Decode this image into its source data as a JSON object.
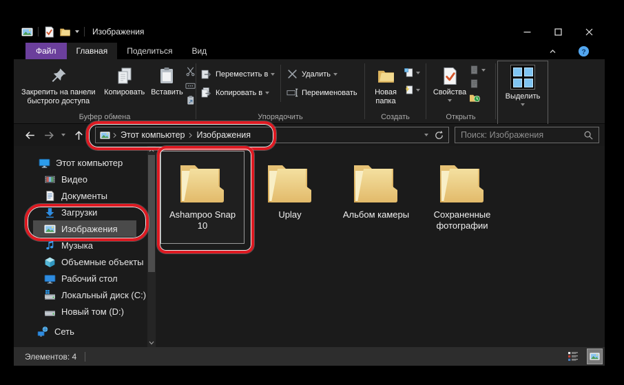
{
  "window": {
    "title": "Изображения"
  },
  "tabs": {
    "file": "Файл",
    "home": "Главная",
    "share": "Поделиться",
    "view": "Вид"
  },
  "ribbon": {
    "pin": "Закрепить на панели быстрого доступа",
    "copy": "Копировать",
    "paste": "Вставить",
    "move_to": "Переместить в",
    "copy_to": "Копировать в",
    "delete": "Удалить",
    "rename": "Переименовать",
    "new_folder": "Новая папка",
    "properties": "Свойства",
    "select": "Выделить",
    "groups": {
      "clipboard": "Буфер обмена",
      "organize": "Упорядочить",
      "create": "Создать",
      "open": "Открыть"
    }
  },
  "address": {
    "crumb_root": "Этот компьютер",
    "crumb_current": "Изображения",
    "search_placeholder": "Поиск: Изображения"
  },
  "sidebar": {
    "items": [
      {
        "label": "Этот компьютер"
      },
      {
        "label": "Видео"
      },
      {
        "label": "Документы"
      },
      {
        "label": "Загрузки"
      },
      {
        "label": "Изображения"
      },
      {
        "label": "Музыка"
      },
      {
        "label": "Объемные объекты"
      },
      {
        "label": "Рабочий стол"
      },
      {
        "label": "Локальный диск (C:)"
      },
      {
        "label": "Новый том (D:)"
      },
      {
        "label": "Сеть"
      }
    ]
  },
  "folders": [
    {
      "name": "Ashampoo Snap 10"
    },
    {
      "name": "Uplay"
    },
    {
      "name": "Альбом камеры"
    },
    {
      "name": "Сохраненные фотографии"
    }
  ],
  "statusbar": {
    "items_count": "Элементов: 4"
  },
  "icons": {
    "breadcrumb_separator": "chevron-right",
    "dropdown": "chevron-down",
    "search": "magnifier",
    "refresh": "circular-arrow",
    "help": "question-circle"
  },
  "colors": {
    "annotation_red": "#de1a22",
    "file_tab_purple": "#6b3f9c",
    "folder_yellow": "#e9c46f",
    "selection_gray": "#4a4a4a",
    "ribbon_bg": "#1e1e1e"
  }
}
